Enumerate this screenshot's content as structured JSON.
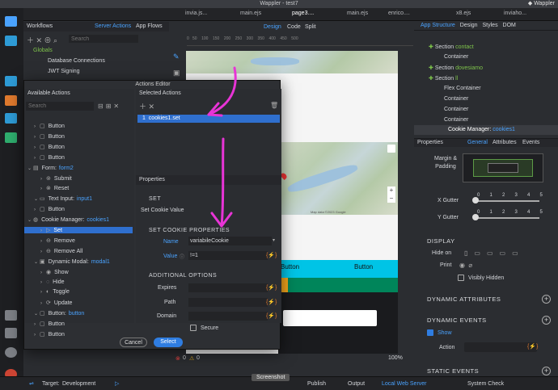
{
  "window": {
    "title": "Wappler - test7"
  },
  "tabs": [
    "invia.js...",
    "main.ejs",
    "page3....",
    "main.ejs",
    "enrico....",
    "x8.ejs",
    "inviaho..."
  ],
  "workflows": {
    "title": "Workflows",
    "tab_server_actions": "Server Actions",
    "tab_app_flows": "App Flows",
    "search_placeholder": "Search",
    "items": [
      {
        "label": "Globals"
      },
      {
        "label": "Database Connections"
      },
      {
        "label": "JWT Signing"
      }
    ]
  },
  "design_toolbar": {
    "design": "Design",
    "code": "Code",
    "split": "Split"
  },
  "canvas": {
    "button1": "Button",
    "button2": "Button",
    "map_attrib": "Map data ©2023 Google"
  },
  "actions_editor": {
    "title": "Actions Editor",
    "available_title": "Available Actions",
    "search_placeholder": "Search",
    "selected_title": "Selected Actions",
    "selected_item_index": "1",
    "selected_item_label": "cookies1.set",
    "tree": [
      {
        "label": "Button"
      },
      {
        "label": "Button"
      },
      {
        "label": "Button"
      },
      {
        "label": "Button"
      },
      {
        "label": "Form:",
        "id": "form2"
      },
      {
        "label": "Submit"
      },
      {
        "label": "Reset"
      },
      {
        "label": "Text Input:",
        "id": "input1"
      },
      {
        "label": "Button"
      },
      {
        "label": "Cookie Manager:",
        "id": "cookies1"
      },
      {
        "label": "Set"
      },
      {
        "label": "Remove"
      },
      {
        "label": "Remove All"
      },
      {
        "label": "Dynamic Modal:",
        "id": "modal1"
      },
      {
        "label": "Show"
      },
      {
        "label": "Hide"
      },
      {
        "label": "Toggle"
      },
      {
        "label": "Update"
      },
      {
        "label": "Button:",
        "id": "button"
      },
      {
        "label": "Button"
      },
      {
        "label": "Button"
      }
    ],
    "properties": {
      "title": "Properties",
      "set_heading": "SET",
      "set_subtitle": "Set Cookie Value",
      "cookie_props_heading": "SET COOKIE PROPERTIES",
      "name_label": "Name",
      "name_value": "variabileCookie",
      "value_label": "Value",
      "value_value": "!=1",
      "additional_heading": "ADDITIONAL OPTIONS",
      "expires_label": "Expires",
      "path_label": "Path",
      "domain_label": "Domain",
      "secure_label": "Secure"
    },
    "cancel_label": "Cancel",
    "select_label": "Select"
  },
  "app_structure": {
    "tabs": [
      "App Structure",
      "Design",
      "Styles",
      "DOM"
    ],
    "items": [
      {
        "label": "Section",
        "id": "contact",
        "kind": "section"
      },
      {
        "label": "Container"
      },
      {
        "label": "Section",
        "id": "dovesiamo",
        "kind": "section"
      },
      {
        "label": "Section",
        "id": "ll",
        "kind": "section"
      },
      {
        "label": "Flex Container"
      },
      {
        "label": "Container"
      },
      {
        "label": "Container"
      },
      {
        "label": "Container"
      },
      {
        "label": "Cookie Manager:",
        "id": "cookies1"
      }
    ]
  },
  "properties_panel": {
    "title": "Properties",
    "tabs": [
      "General",
      "Attributes",
      "Events"
    ],
    "margin_padding_label": "Margin & Padding",
    "x_gutter_label": "X Gutter",
    "y_gutter_label": "Y Gutter",
    "gutter_ticks": [
      "0",
      "1",
      "2",
      "3",
      "4",
      "5"
    ],
    "display_heading": "DISPLAY",
    "hide_on_label": "Hide on",
    "print_label": "Print",
    "visibly_hidden_label": "Visibly Hidden",
    "dynamic_attributes": "DYNAMIC ATTRIBUTES",
    "dynamic_events": "DYNAMIC EVENTS",
    "show_label": "Show",
    "action_label": "Action",
    "static_events": "STATIC EVENTS"
  },
  "bottom_bar": {
    "zoom": "100%",
    "errors": "0",
    "warnings": "0",
    "target_label": "Target:",
    "target_value": "Development",
    "screenshot": "Screenshot",
    "publish": "Publish",
    "output": "Output",
    "local_server": "Local Web Server",
    "system_check": "System Check"
  },
  "colors": {
    "accent": "#4aa3ff",
    "annotation": "#e834d6",
    "cyan_button": "#00c4e6",
    "teal_button": "#00855a"
  }
}
